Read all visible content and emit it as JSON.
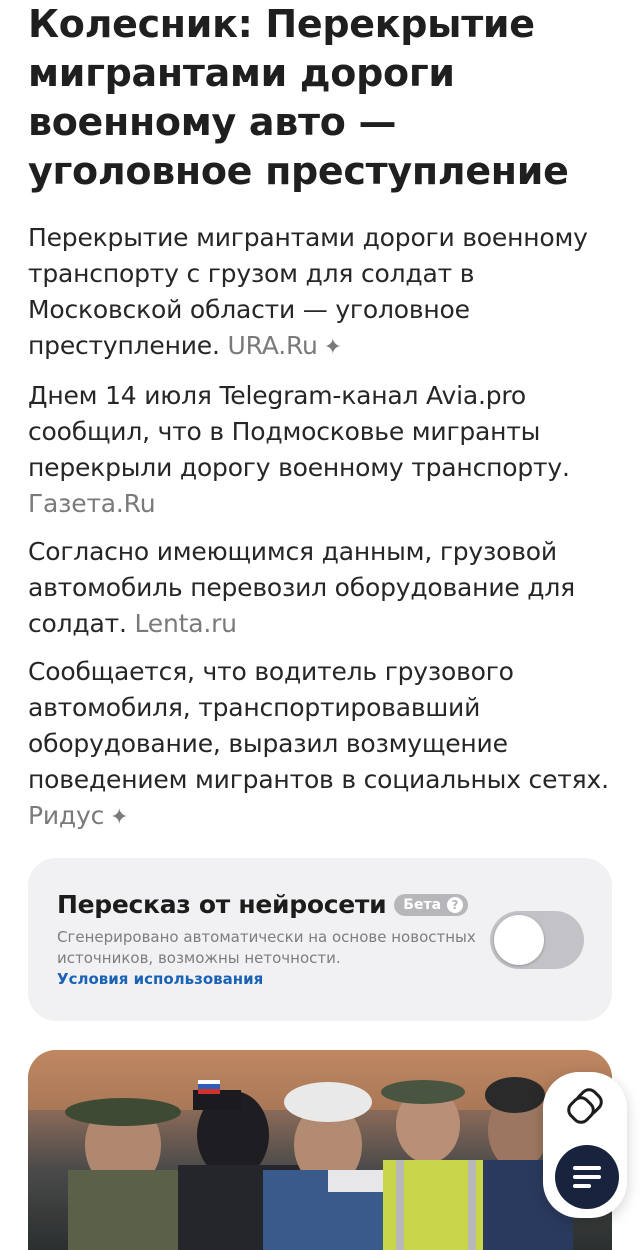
{
  "article": {
    "headline": "Колесник: Перекрытие мигрантами дороги военному авто — уголовное преступление",
    "paragraphs": [
      {
        "text": "Перекрытие мигрантами дороги военному транспорту с грузом для солдат в Московской области — уголовное преступление.",
        "source": "URA.Ru",
        "sparkle": "✦"
      },
      {
        "text": "Днем 14 июля Telegram-канал Avia.pro сообщил, что в Подмосковье мигранты перекрыли дорогу военному транспорту.",
        "source": "Газета.Ru",
        "sparkle": ""
      },
      {
        "text": "Согласно имеющимся данным, грузовой автомобиль перевозил оборудование для солдат.",
        "source": "Lenta.ru",
        "sparkle": ""
      },
      {
        "text": "Сообщается, что водитель грузового автомобиля, транспортировавший оборудование, выразил возмущение поведением мигрантов в социальных сетях.",
        "source": "Ридус",
        "sparkle": "✦"
      }
    ]
  },
  "ai_summary": {
    "title": "Пересказ от нейросети",
    "badge": "Бета",
    "badge_icon": "?",
    "description": "Сгенерировано автоматически на основе новостных источников, возможны неточности.",
    "terms_link": "Условия использования",
    "toggle_on": false
  },
  "photo": {
    "icon": "news-photo"
  },
  "fab": {
    "copy_icon": "copy-icon",
    "menu_icon": "menu-icon"
  },
  "colors": {
    "link": "#1a62b5",
    "source": "#7a7a7a",
    "card_bg": "#f1f1f3",
    "fab_menu_bg": "#18233d"
  }
}
